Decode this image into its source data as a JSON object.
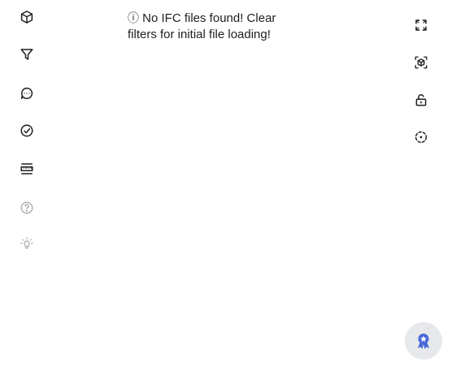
{
  "message": {
    "info_glyph": "ⓘ",
    "text_line1": "No IFC files found! Clear",
    "text_line2": "filters for initial file loading!"
  },
  "left_toolbar": {
    "items": [
      {
        "icon": "cube-icon",
        "enabled": true
      },
      {
        "icon": "filter-icon",
        "enabled": true
      },
      {
        "icon": "comment-icon",
        "enabled": true
      },
      {
        "icon": "check-circle-icon",
        "enabled": true
      },
      {
        "icon": "measure-ruler-icon",
        "enabled": true
      },
      {
        "icon": "help-icon",
        "enabled": false
      },
      {
        "icon": "lightbulb-icon",
        "enabled": false
      }
    ]
  },
  "right_toolbar": {
    "items": [
      {
        "icon": "fullscreen-icon"
      },
      {
        "icon": "focus-model-icon"
      },
      {
        "icon": "unlock-icon"
      },
      {
        "icon": "orbit-icon"
      }
    ]
  },
  "fab": {
    "icon": "award-badge-icon"
  },
  "colors": {
    "icon_active": "#1f1f1f",
    "icon_disabled": "#a9a9a9",
    "fab_background": "#e6e8ec",
    "fab_icon": "#4a6ad8"
  }
}
